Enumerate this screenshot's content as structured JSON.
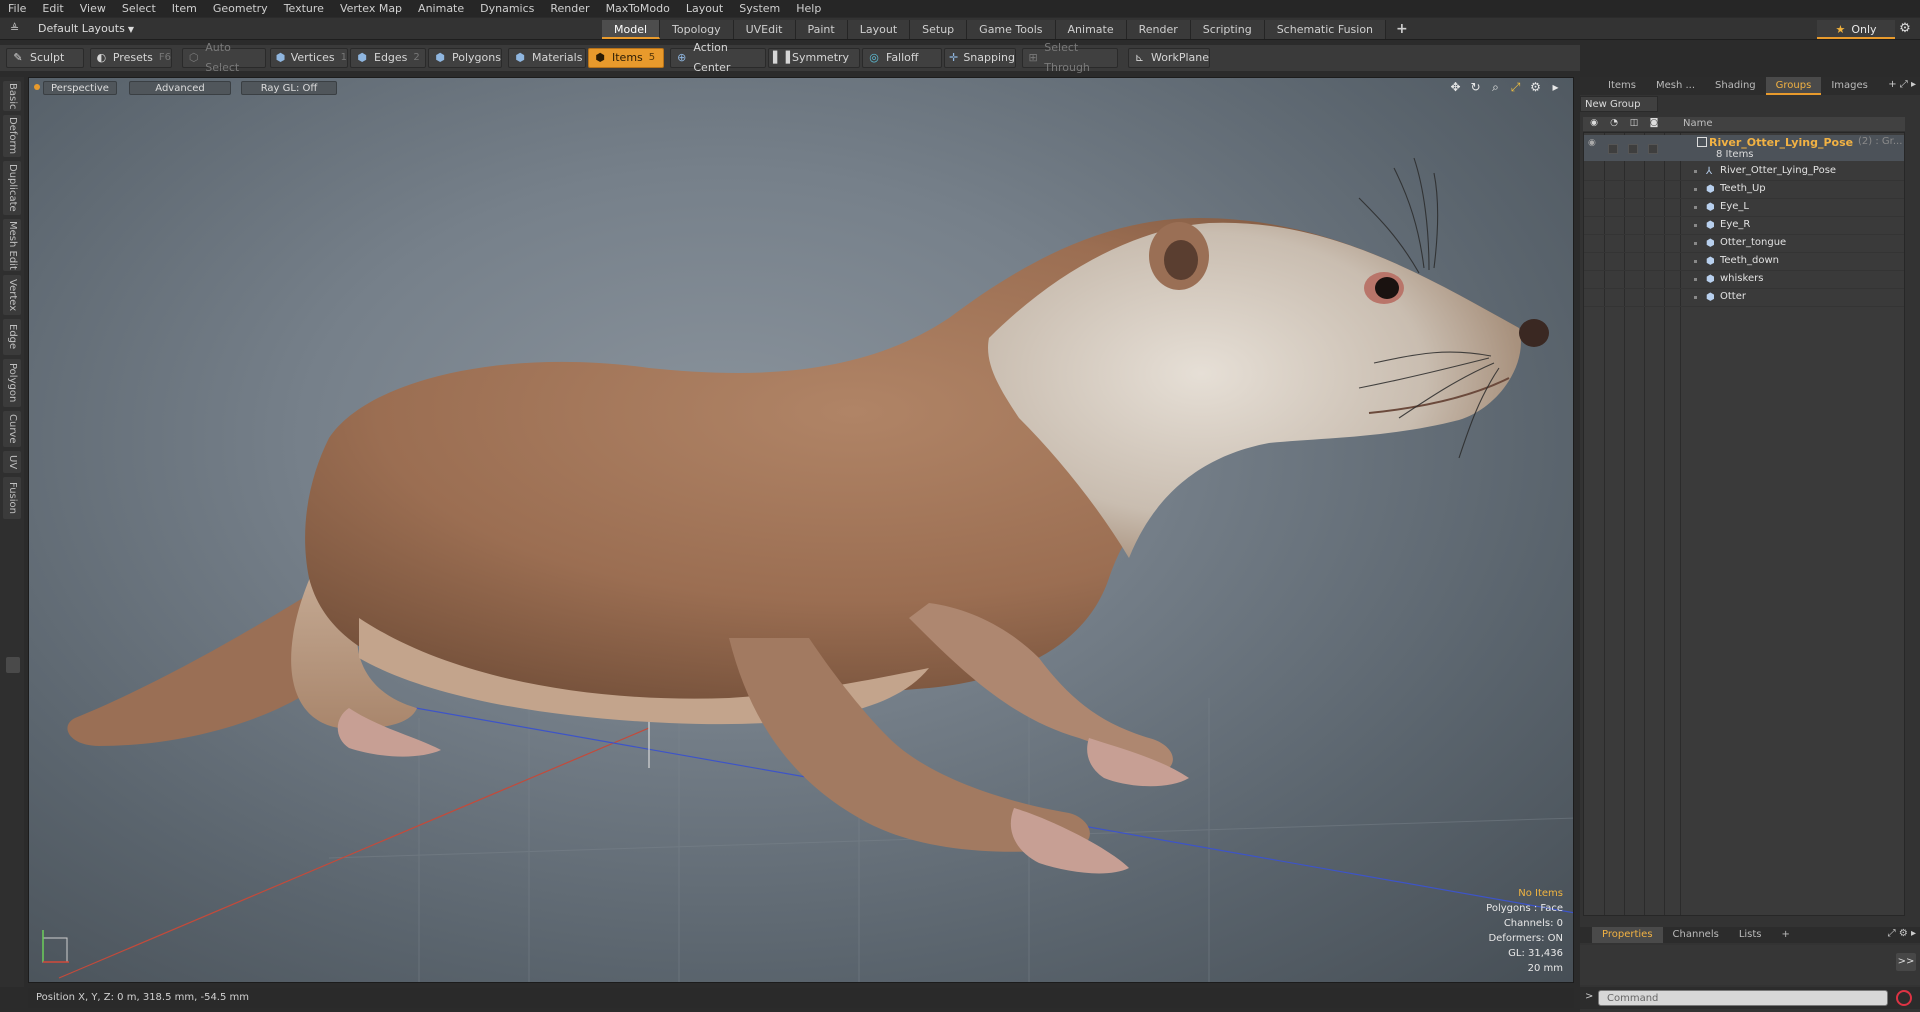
{
  "menu": [
    "File",
    "Edit",
    "View",
    "Select",
    "Item",
    "Geometry",
    "Texture",
    "Vertex Map",
    "Animate",
    "Dynamics",
    "Render",
    "MaxToModo",
    "Layout",
    "System",
    "Help"
  ],
  "layout": {
    "selected": "Default Layouts"
  },
  "tabs": [
    {
      "label": "Model",
      "active": true
    },
    {
      "label": "Topology"
    },
    {
      "label": "UVEdit"
    },
    {
      "label": "Paint"
    },
    {
      "label": "Layout"
    },
    {
      "label": "Setup"
    },
    {
      "label": "Game Tools"
    },
    {
      "label": "Animate"
    },
    {
      "label": "Render"
    },
    {
      "label": "Scripting"
    },
    {
      "label": "Schematic Fusion"
    }
  ],
  "tabs_add": "+",
  "only_label": "Only",
  "toolbar": {
    "sculpt": "Sculpt",
    "presets": "Presets",
    "presets_key": "F6",
    "auto_select": "Auto Select",
    "vertices": "Vertices",
    "vertices_key": "1",
    "edges": "Edges",
    "edges_key": "2",
    "polygons": "Polygons",
    "materials": "Materials",
    "items": "Items",
    "items_key": "5",
    "action_center": "Action Center",
    "symmetry": "Symmetry",
    "falloff": "Falloff",
    "snapping": "Snapping",
    "select_through": "Select Through",
    "workplane": "WorkPlane"
  },
  "left_tabs": [
    "Basic",
    "Deform",
    "Duplicate",
    "Mesh Edit",
    "Vertex",
    "Edge",
    "Polygon",
    "Curve",
    "UV",
    "Fusion"
  ],
  "viewport": {
    "view": "Perspective",
    "shading": "Advanced",
    "raygl": "Ray GL: Off",
    "stats": {
      "selection": "No Items",
      "polygons": "Polygons : Face",
      "channels": "Channels: 0",
      "deformers": "Deformers: ON",
      "gl": "GL: 31,436",
      "grid": "20 mm"
    }
  },
  "status": "Position X, Y, Z:  0 m, 318.5 mm, -54.5 mm",
  "right_panel": {
    "tabs": [
      {
        "label": "Items"
      },
      {
        "label": "Mesh ..."
      },
      {
        "label": "Shading"
      },
      {
        "label": "Groups",
        "active": true
      },
      {
        "label": "Images"
      }
    ],
    "new_group": "New Group",
    "column_name": "Name",
    "group": {
      "name": "River_Otter_Lying_Pose",
      "suffix": "(2) : Gr...",
      "count": "8 Items"
    },
    "items": [
      {
        "name": "River_Otter_Lying_Pose",
        "icon": "locator-icon"
      },
      {
        "name": "Teeth_Up",
        "icon": "mesh-icon"
      },
      {
        "name": "Eye_L",
        "icon": "mesh-icon"
      },
      {
        "name": "Eye_R",
        "icon": "mesh-icon"
      },
      {
        "name": "Otter_tongue",
        "icon": "mesh-icon"
      },
      {
        "name": "Teeth_down",
        "icon": "mesh-icon"
      },
      {
        "name": "whiskers",
        "icon": "mesh-icon"
      },
      {
        "name": "Otter",
        "icon": "mesh-icon"
      }
    ],
    "props_tabs": [
      {
        "label": "Properties",
        "active": true
      },
      {
        "label": "Channels"
      },
      {
        "label": "Lists"
      }
    ],
    "props_add": "+",
    "expand": ">>",
    "command_placeholder": "Command"
  },
  "colors": {
    "accent": "#e89a2c",
    "group_name": "#f2b243",
    "viewport_bg": "#76808a"
  }
}
